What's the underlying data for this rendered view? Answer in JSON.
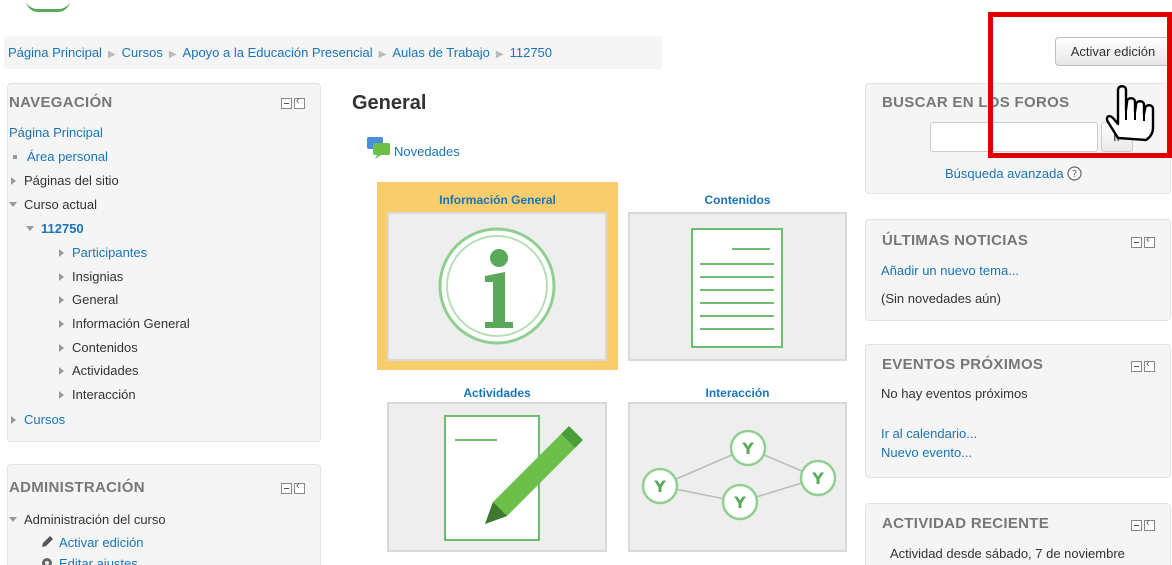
{
  "breadcrumb": {
    "items": [
      "Página Principal",
      "Cursos",
      "Apoyo a la Educación Presencial",
      "Aulas de Trabajo",
      "112750"
    ]
  },
  "header": {
    "edit_button": "Activar edición"
  },
  "navigation": {
    "title": "NAVEGACIÓN",
    "home": "Página Principal",
    "personal": "Área personal",
    "site_pages": "Páginas del sitio",
    "current_course": "Curso actual",
    "course_code": "112750",
    "course_items": [
      "Participantes",
      "Insignias",
      "General",
      "Información General",
      "Contenidos",
      "Actividades",
      "Interacción"
    ],
    "courses": "Cursos"
  },
  "administration": {
    "title": "ADMINISTRACIÓN",
    "course_admin": "Administración del curso",
    "edit_toggle": "Activar edición",
    "edit_settings": "Editar ajustes"
  },
  "main": {
    "section_title": "General",
    "news_link": "Novedades",
    "tiles": [
      "Información General",
      "Contenidos",
      "Actividades",
      "Interacción"
    ]
  },
  "search_forums": {
    "title": "BUSCAR EN LOS FOROS",
    "go_button": "Ir",
    "advanced": "Búsqueda avanzada",
    "query": ""
  },
  "latest_news": {
    "title": "ÚLTIMAS NOTICIAS",
    "add_topic": "Añadir un nuevo tema...",
    "empty": "(Sin novedades aún)"
  },
  "upcoming_events": {
    "title": "EVENTOS PRÓXIMOS",
    "empty": "No hay eventos próximos",
    "go_calendar": "Ir al calendario...",
    "new_event": "Nuevo evento..."
  },
  "recent_activity": {
    "title": "ACTIVIDAD RECIENTE",
    "since": "Actividad desde sábado, 7 de noviembre"
  },
  "colors": {
    "link": "#1a74b8",
    "highlight": "#e30000",
    "tile_highlight": "#f9cd6b",
    "accent_green": "#5aa85a"
  }
}
